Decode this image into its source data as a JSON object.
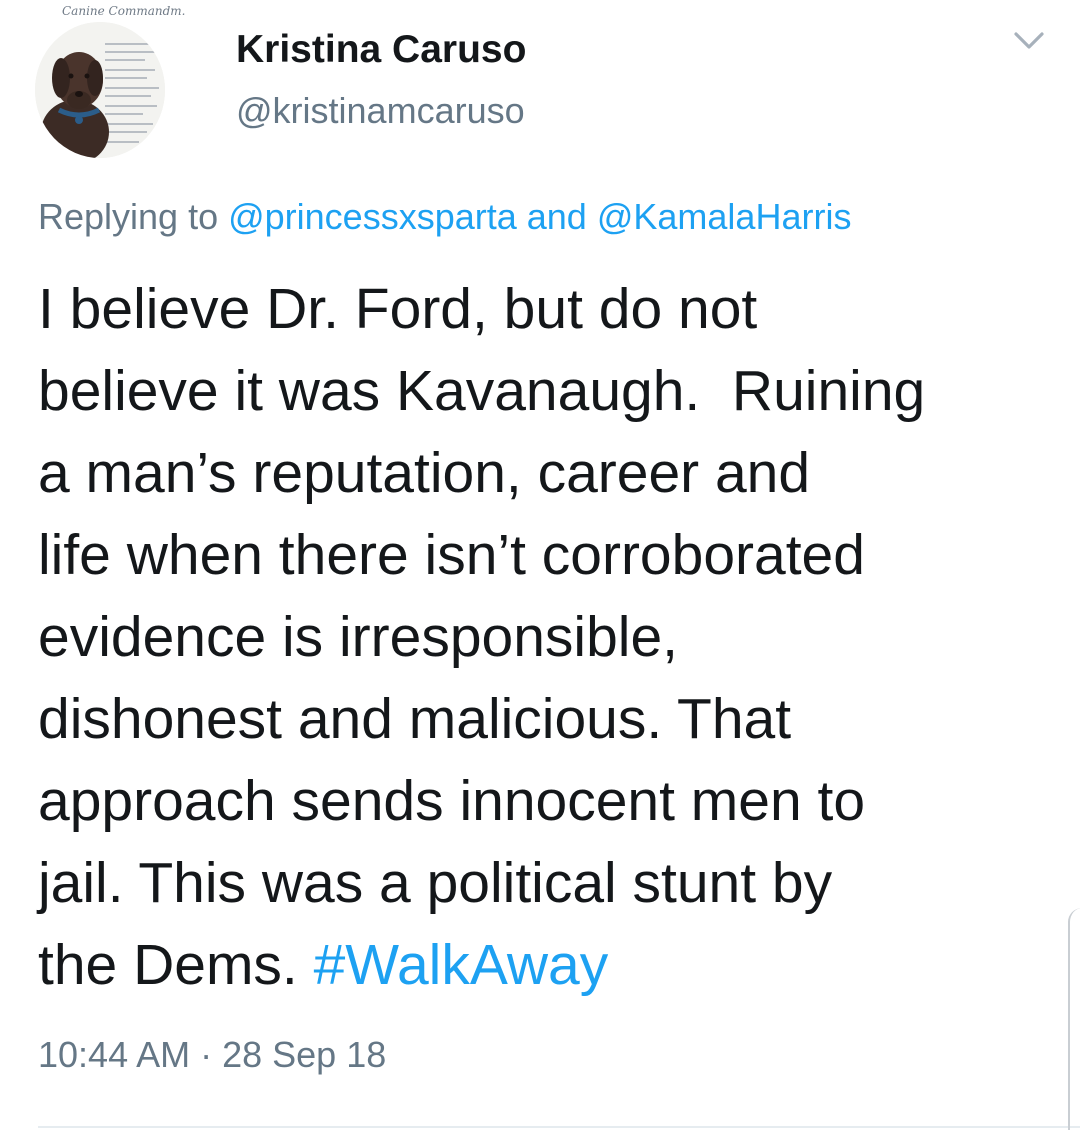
{
  "user": {
    "display_name": "Kristina Caruso",
    "handle": "@kristinamcaruso",
    "avatar_caption": "Canine Commandm."
  },
  "reply": {
    "prefix": "Replying to ",
    "mention_1": "@princessxsparta",
    "joiner": " and ",
    "mention_2": "@KamalaHarris"
  },
  "tweet": {
    "lines": [
      "I believe Dr. Ford, but do not",
      "believe it was Kavanaugh.  Ruining",
      "a man’s reputation, career and",
      "life when there isn’t corroborated",
      "evidence is irresponsible,",
      "dishonest and malicious. That",
      "approach sends innocent men to",
      "jail. This was a political stunt by",
      "the Dems. "
    ],
    "hashtag": "#WalkAway",
    "timestamp": "10:44 AM · 28 Sep 18"
  },
  "icons": {
    "menu": "chevron-down-icon"
  },
  "colors": {
    "link": "#1da1f2",
    "secondary_text": "#657786",
    "primary_text": "#14171a"
  }
}
